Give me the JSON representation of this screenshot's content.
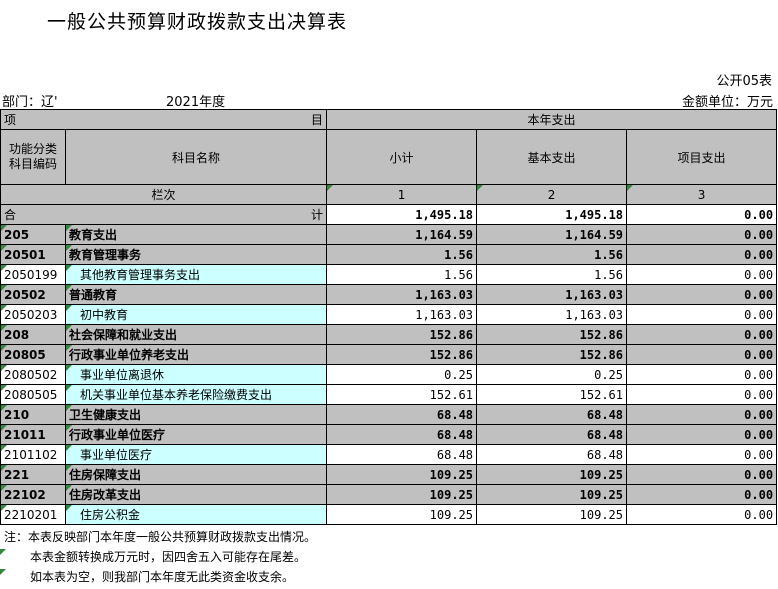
{
  "title": "一般公共预算财政拨款支出决算表",
  "form_no": "公开05表",
  "dept_label": "部门：辽'",
  "year": "2021年度",
  "unit": "金额单位：万元",
  "header": {
    "xiang": "项",
    "mu": "目",
    "current_year": "本年支出",
    "code_col": "功能分类\n科目编码",
    "name_col": "科目名称",
    "subtotal": "小计",
    "basic": "基本支出",
    "project": "项目支出",
    "lanci": "栏次",
    "n1": "1",
    "n2": "2",
    "n3": "3",
    "he": "合",
    "ji": "计",
    "total_subtotal": "1,495.18",
    "total_basic": "1,495.18",
    "total_project": "0.00"
  },
  "rows": [
    {
      "code": "205",
      "name": "教育支出",
      "v1": "1,164.59",
      "v2": "1,164.59",
      "v3": "0.00",
      "lvl": "head"
    },
    {
      "code": "20501",
      "name": "教育管理事务",
      "v1": "1.56",
      "v2": "1.56",
      "v3": "0.00",
      "lvl": "head"
    },
    {
      "code": "2050199",
      "name": "其他教育管理事务支出",
      "v1": "1.56",
      "v2": "1.56",
      "v3": "0.00",
      "lvl": "leaf"
    },
    {
      "code": "20502",
      "name": "普通教育",
      "v1": "1,163.03",
      "v2": "1,163.03",
      "v3": "0.00",
      "lvl": "head"
    },
    {
      "code": "2050203",
      "name": "初中教育",
      "v1": "1,163.03",
      "v2": "1,163.03",
      "v3": "0.00",
      "lvl": "leaf"
    },
    {
      "code": "208",
      "name": "社会保障和就业支出",
      "v1": "152.86",
      "v2": "152.86",
      "v3": "0.00",
      "lvl": "head"
    },
    {
      "code": "20805",
      "name": "行政事业单位养老支出",
      "v1": "152.86",
      "v2": "152.86",
      "v3": "0.00",
      "lvl": "head"
    },
    {
      "code": "2080502",
      "name": "事业单位离退休",
      "v1": "0.25",
      "v2": "0.25",
      "v3": "0.00",
      "lvl": "leaf"
    },
    {
      "code": "2080505",
      "name": "机关事业单位基本养老保险缴费支出",
      "v1": "152.61",
      "v2": "152.61",
      "v3": "0.00",
      "lvl": "leaf"
    },
    {
      "code": "210",
      "name": "卫生健康支出",
      "v1": "68.48",
      "v2": "68.48",
      "v3": "0.00",
      "lvl": "head"
    },
    {
      "code": "21011",
      "name": "行政事业单位医疗",
      "v1": "68.48",
      "v2": "68.48",
      "v3": "0.00",
      "lvl": "head"
    },
    {
      "code": "2101102",
      "name": "事业单位医疗",
      "v1": "68.48",
      "v2": "68.48",
      "v3": "0.00",
      "lvl": "leaf"
    },
    {
      "code": "221",
      "name": "住房保障支出",
      "v1": "109.25",
      "v2": "109.25",
      "v3": "0.00",
      "lvl": "head"
    },
    {
      "code": "22102",
      "name": "住房改革支出",
      "v1": "109.25",
      "v2": "109.25",
      "v3": "0.00",
      "lvl": "head"
    },
    {
      "code": "2210201",
      "name": "住房公积金",
      "v1": "109.25",
      "v2": "109.25",
      "v3": "0.00",
      "lvl": "leaf"
    }
  ],
  "notes": [
    "注：本表反映部门本年度一般公共预算财政拨款支出情况。",
    "本表金额转换成万元时，因四舍五入可能存在尾差。",
    "如本表为空，则我部门本年度无此类资金收支余。"
  ]
}
